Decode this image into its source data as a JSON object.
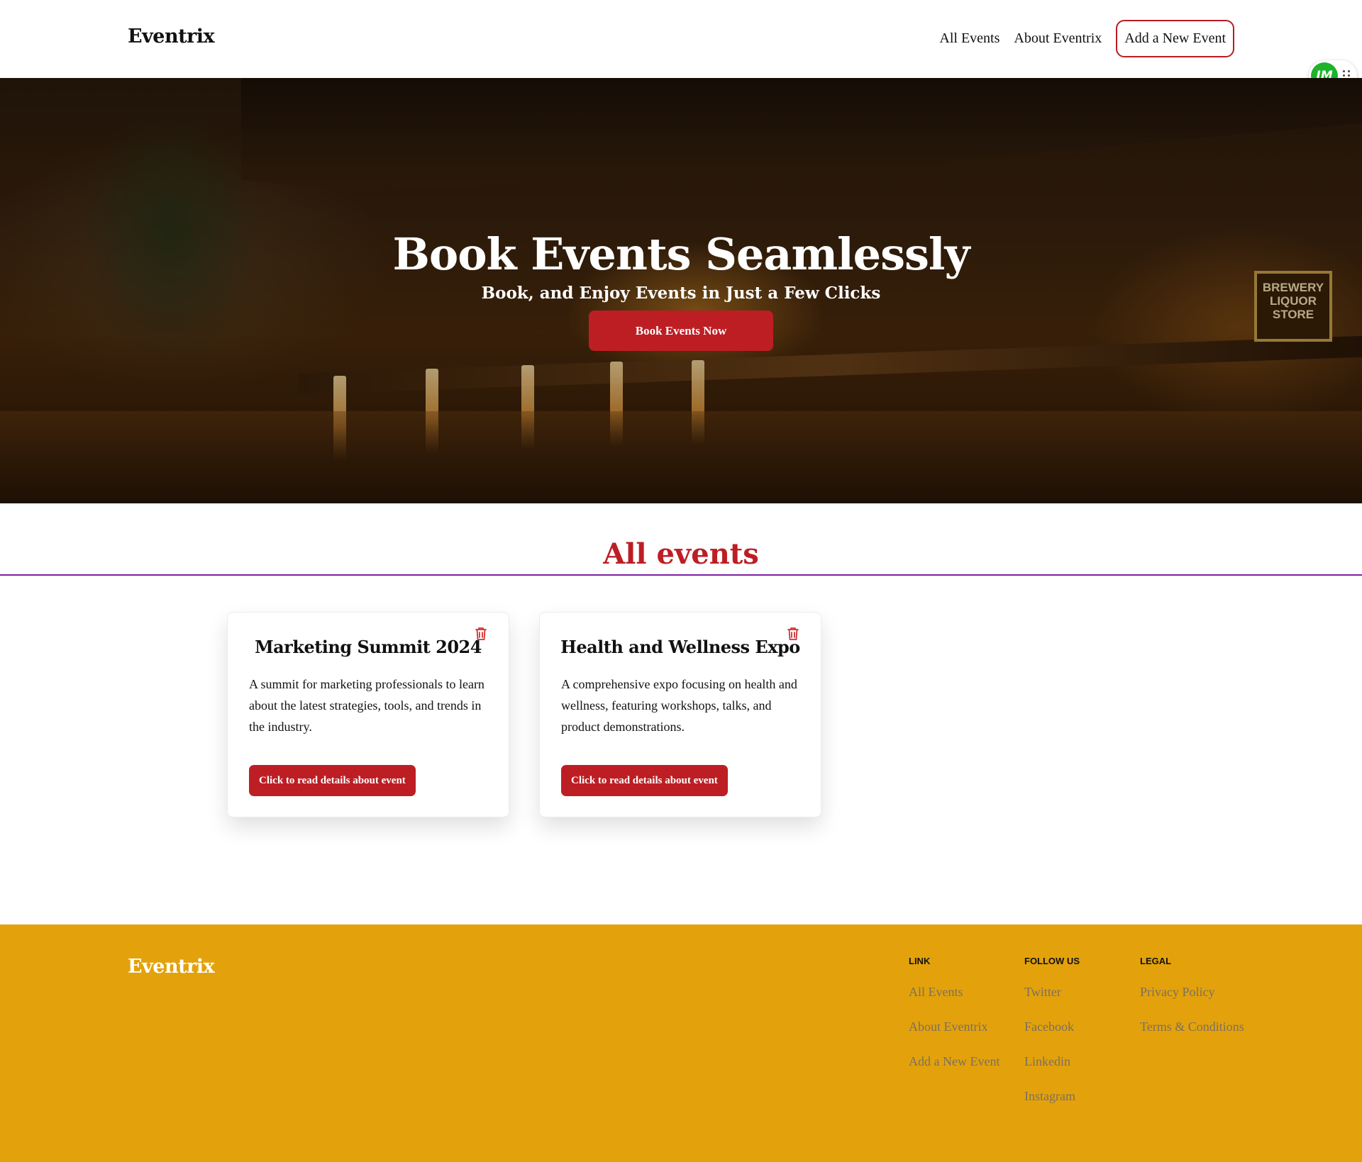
{
  "navbar": {
    "brand": "Eventrix",
    "links": [
      "All Events",
      "About Eventrix"
    ],
    "cta": "Add a New Event"
  },
  "extension": {
    "label": "IM"
  },
  "hero": {
    "title": "Book Events Seamlessly",
    "subtitle": "Book, and Enjoy Events in Just a Few Clicks",
    "button": "Book Events Now",
    "sign_text": "BREWERY LIQUOR STORE"
  },
  "events_section": {
    "title": "All events",
    "cards": [
      {
        "title": "Marketing Summit 2024",
        "description": "A summit for marketing professionals to learn about the latest strategies, tools, and trends in the industry.",
        "button": "Click to read details about event"
      },
      {
        "title": "Health and Wellness Expo",
        "description": "A comprehensive expo focusing on health and wellness, featuring workshops, talks, and product demonstrations.",
        "button": "Click to read details about event"
      }
    ]
  },
  "footer": {
    "brand": "Eventrix",
    "columns": [
      {
        "heading": "LINK",
        "links": [
          "All Events",
          "About Eventrix",
          "Add a New Event"
        ]
      },
      {
        "heading": "FOLLOW US",
        "links": [
          "Twitter",
          "Facebook",
          "Linkedin",
          "Instagram"
        ]
      },
      {
        "heading": "LEGAL",
        "links": [
          "Privacy Policy",
          "Terms & Conditions"
        ]
      }
    ]
  },
  "colors": {
    "accent_red": "#bd1e24",
    "footer_bg": "#e3a20b",
    "divider": "#7b1fa2",
    "footer_link": "#7a6f63"
  }
}
